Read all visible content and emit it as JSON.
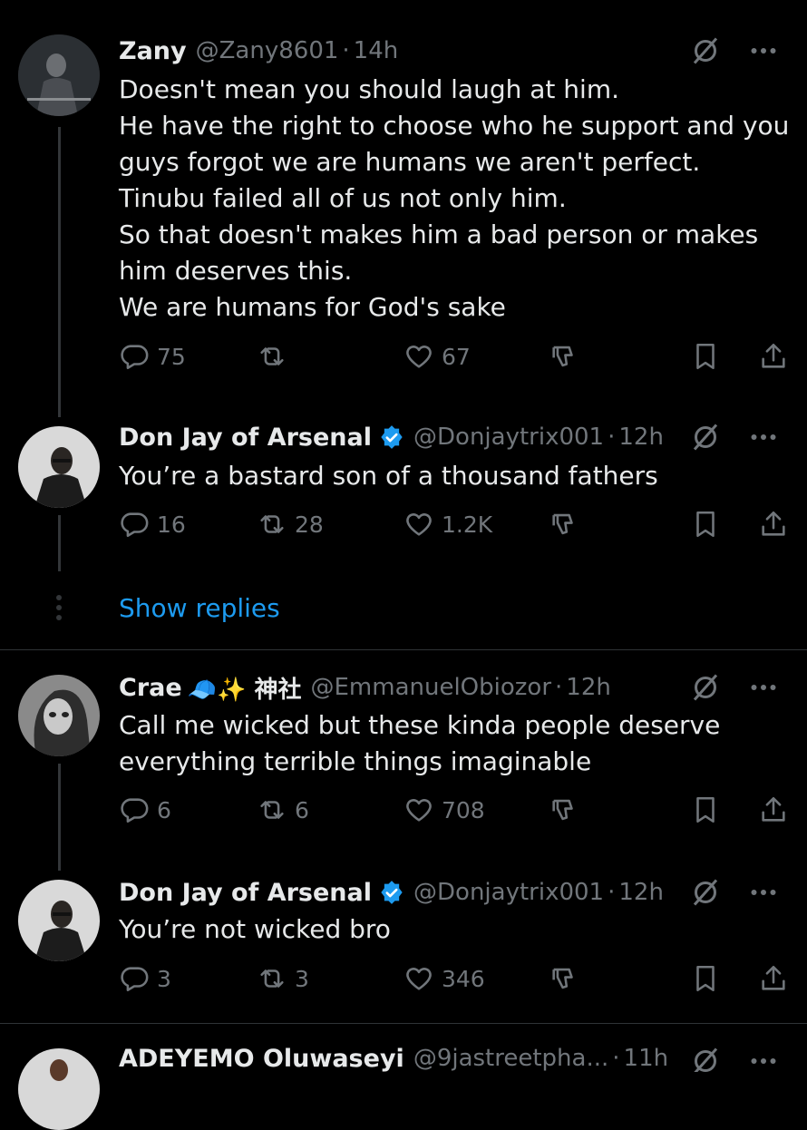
{
  "tweets": [
    {
      "name": "Zany",
      "handle": "@Zany8601",
      "time": "14h",
      "lines": [
        "Doesn't mean you should laugh at him.",
        "He have the right to choose who he support and you",
        "guys forgot we are humans we aren't perfect.",
        "Tinubu failed all of us not only him.",
        "So that doesn't makes him a bad person or makes",
        "him deserves this.",
        "We are humans for God's sake"
      ],
      "replies": "75",
      "reposts": "",
      "likes": "67"
    },
    {
      "name": "Don Jay of Arsenal",
      "handle": "@Donjaytrix001",
      "time": "12h",
      "lines": [
        "You’re a bastard son of a thousand fathers"
      ],
      "replies": "16",
      "reposts": "28",
      "likes": "1.2K"
    },
    {
      "name": "Crae",
      "name_suffix": "🧢✨ 神社",
      "handle": "@EmmanuelObiozor",
      "time": "12h",
      "lines": [
        "Call me wicked but these kinda people deserve",
        "everything terrible things imaginable"
      ],
      "replies": "6",
      "reposts": "6",
      "likes": "708"
    },
    {
      "name": "Don Jay of Arsenal",
      "handle": "@Donjaytrix001",
      "time": "12h",
      "lines": [
        "You’re not wicked bro"
      ],
      "replies": "3",
      "reposts": "3",
      "likes": "346"
    },
    {
      "name": "ADEYEMO Oluwaseyi",
      "handle": "@9jastreetpha...",
      "time": "11h"
    }
  ],
  "show_replies": "Show replies",
  "separator": "·",
  "colors": {
    "background": "#000000",
    "text": "#e7e9ea",
    "muted": "#71767b",
    "accent": "#1d9bf0"
  },
  "icons": [
    "reply-icon",
    "repost-icon",
    "like-icon",
    "downvote-icon",
    "bookmark-icon",
    "share-icon",
    "grok-icon",
    "more-icon",
    "verified-icon"
  ]
}
